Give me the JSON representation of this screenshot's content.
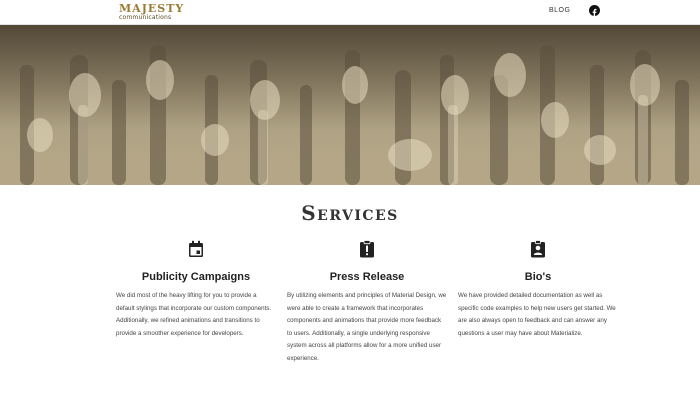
{
  "nav": {
    "logo_top": "MAJESTY",
    "logo_bottom": "communications",
    "blog_label": "BLOG",
    "facebook_icon": "facebook-icon"
  },
  "hero": {
    "image": "crowd-raised-hands-photo",
    "tone": "#a89a7a"
  },
  "services": {
    "title": "Services",
    "items": [
      {
        "icon": "calendar-icon",
        "heading": "Publicity Campaigns",
        "text": "We did most of the heavy lifting for you to provide a default stylings that incorporate our custom components. Additionally, we refined animations and transitions to provide a smoother experience for developers."
      },
      {
        "icon": "alert-clipboard-icon",
        "heading": "Press Release",
        "text": "By utilizing elements and principles of Material Design, we were able to create a framework that incorporates components and animations that provide more feedback to users. Additionally, a single underlying responsive system across all platforms allow for a more unified user experience."
      },
      {
        "icon": "contact-badge-icon",
        "heading": "Bio's",
        "text": "We have provided detailed documentation as well as specific code examples to help new users get started. We are also always open to feedback and can answer any questions a user may have about Materialize."
      }
    ]
  }
}
